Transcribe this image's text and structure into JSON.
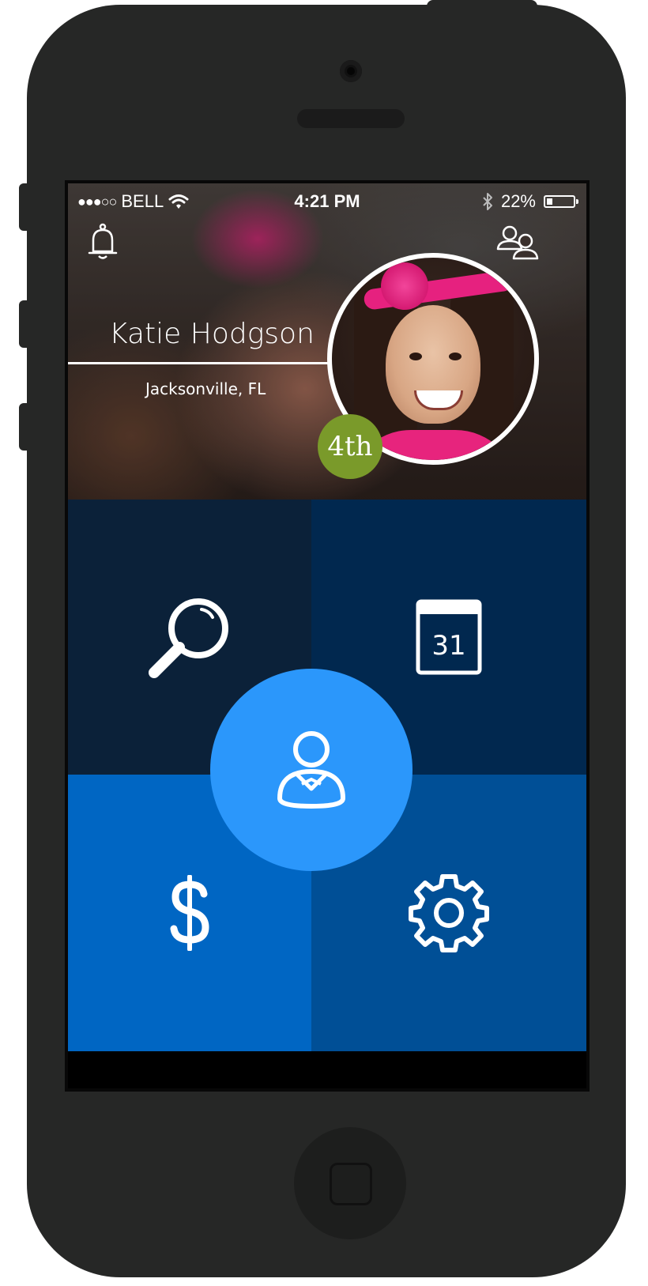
{
  "status_bar": {
    "signal": "●●●○○",
    "carrier": "BELL",
    "time": "4:21 PM",
    "battery_text": "22%",
    "battery_level": 0.22
  },
  "header": {
    "notifications_icon": "bell-icon",
    "people_icon": "people-icon"
  },
  "profile": {
    "name": "Katie Hodgson",
    "location": "Jacksonville, FL",
    "grade": "4th"
  },
  "tiles": {
    "search_icon": "search-icon",
    "calendar_day": "31",
    "money_icon": "dollar-icon",
    "settings_icon": "gear-icon",
    "profile_icon": "person-icon"
  },
  "colors": {
    "tile_search": "#0b2139",
    "tile_calendar": "#01284f",
    "tile_money": "#0066c3",
    "tile_settings": "#004f96",
    "center_button": "#2b97fb",
    "grade_badge": "#7a9a2a"
  }
}
